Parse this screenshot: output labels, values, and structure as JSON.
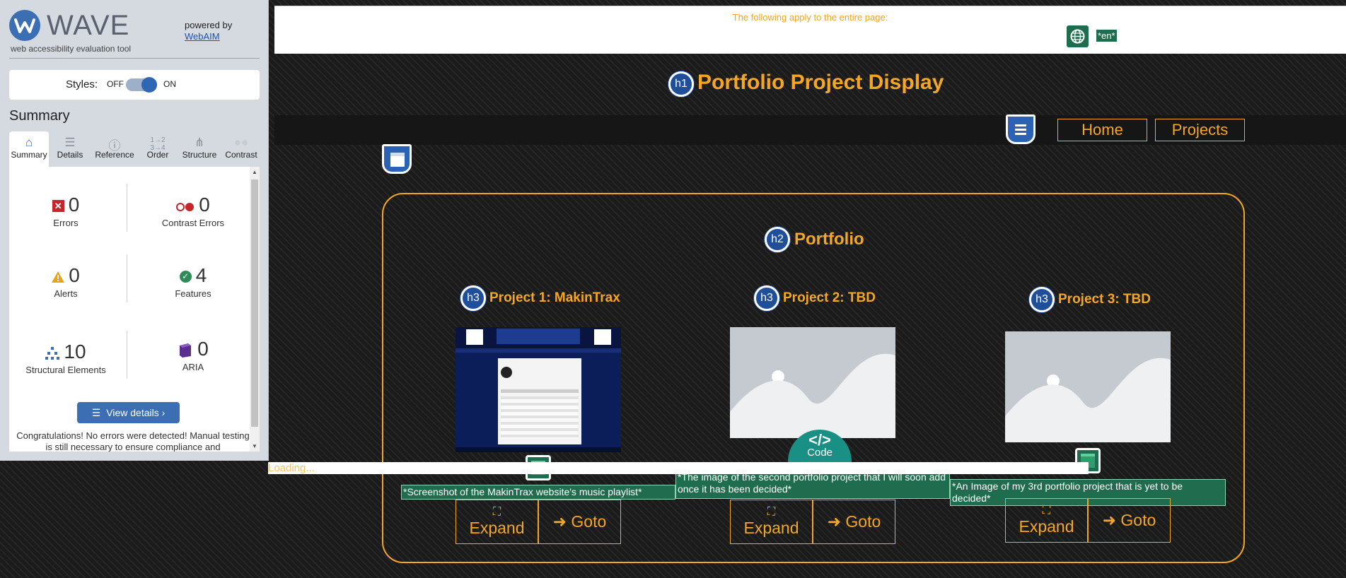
{
  "wave": {
    "title": "WAVE",
    "subtitle": "web accessibility evaluation tool",
    "powered_by": "powered by",
    "webaim_link": "WebAIM",
    "styles_label": "Styles:",
    "styles_off": "OFF",
    "styles_on": "ON",
    "summary_heading": "Summary",
    "tabs": [
      {
        "label": "Summary",
        "icon": "home-icon"
      },
      {
        "label": "Details",
        "icon": "list-icon"
      },
      {
        "label": "Reference",
        "icon": "info-icon"
      },
      {
        "label": "Order",
        "icon": "order-icon"
      },
      {
        "label": "Structure",
        "icon": "structure-icon"
      },
      {
        "label": "Contrast",
        "icon": "contrast-icon"
      }
    ],
    "stats": {
      "errors": {
        "value": "0",
        "label": "Errors"
      },
      "contrast_errors": {
        "value": "0",
        "label": "Contrast Errors"
      },
      "alerts": {
        "value": "0",
        "label": "Alerts"
      },
      "features": {
        "value": "4",
        "label": "Features"
      },
      "structural": {
        "value": "10",
        "label": "Structural Elements"
      },
      "aria": {
        "value": "0",
        "label": "ARIA"
      }
    },
    "view_details": "View details ›",
    "congrats": "Congratulations! No errors were detected! Manual testing is still necessary to ensure compliance and"
  },
  "page": {
    "lang_notice": "The following apply to the entire page:",
    "lang_tag": "*en*",
    "h1_badge": "h1",
    "title": "Portfolio Project Display",
    "nav": {
      "home": "Home",
      "projects": "Projects"
    },
    "portfolio": {
      "h2_badge": "h2",
      "heading": "Portfolio",
      "projects": [
        {
          "badge": "h3",
          "title": "Project 1: MakinTrax",
          "alt": "*Screenshot of the MakinTrax website's music playlist*",
          "expand": "Expand",
          "goto": "➜ Goto"
        },
        {
          "badge": "h3",
          "title": "Project 2: TBD",
          "alt": "*The image of the second portfolio project that I will soon add once it has been decided*",
          "expand": "Expand",
          "goto": "➜ Goto"
        },
        {
          "badge": "h3",
          "title": "Project 3: TBD",
          "alt": "*An Image of my 3rd portfolio project that is yet to be decided*",
          "expand": "Expand",
          "goto": "➜ Goto"
        }
      ]
    },
    "code_badge": "Code",
    "loading": "Loading...",
    "colors": {
      "accent": "#f5a623",
      "wave_blue": "#3c6eb4",
      "feature_green": "#1f6d4e"
    }
  }
}
